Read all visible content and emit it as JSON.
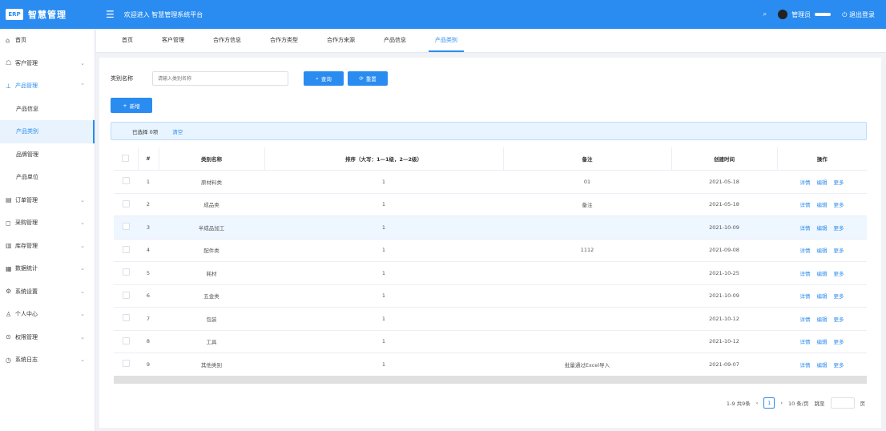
{
  "header": {
    "logo_badge": "ERP",
    "logo_text": "智慧管理",
    "app_title": "欢迎进入 智慧管理系统平台",
    "search_icon": "search-icon",
    "user_name": "管理员",
    "logout": "退出登录"
  },
  "sidebar": {
    "items": [
      {
        "label": "首页",
        "icon": "home-icon",
        "has_arrow": false
      },
      {
        "label": "客户管理",
        "icon": "user-icon",
        "has_arrow": true
      },
      {
        "label": "产品管理",
        "icon": "box-icon",
        "has_arrow": true,
        "open": true
      },
      {
        "label": "产品信息",
        "sub": true
      },
      {
        "label": "产品类别",
        "sub": true,
        "active": true
      },
      {
        "label": "品牌管理",
        "sub": true
      },
      {
        "label": "产品单位",
        "sub": true
      },
      {
        "label": "订单管理",
        "icon": "order-icon",
        "has_arrow": true
      },
      {
        "label": "采购管理",
        "icon": "cart-icon",
        "has_arrow": true
      },
      {
        "label": "库存管理",
        "icon": "stock-icon",
        "has_arrow": true
      },
      {
        "label": "数据统计",
        "icon": "chart-icon",
        "has_arrow": true
      },
      {
        "label": "系统设置",
        "icon": "gear-icon",
        "has_arrow": true
      },
      {
        "label": "个人中心",
        "icon": "person-icon",
        "has_arrow": true
      },
      {
        "label": "权限管理",
        "icon": "lock-icon",
        "has_arrow": true
      },
      {
        "label": "系统日志",
        "icon": "log-icon",
        "has_arrow": true
      }
    ]
  },
  "tabs": [
    "首页",
    "客户管理",
    "合作方信息",
    "合作方类型",
    "合作方来源",
    "产品信息",
    "产品类别"
  ],
  "active_tab": 6,
  "search": {
    "label": "类别名称",
    "placeholder": "请输入类别名称",
    "search_btn": "查询",
    "reset_btn": "重置"
  },
  "add_btn": "新增",
  "selection": {
    "text": "已选择 0项",
    "clear": "清空"
  },
  "table": {
    "columns": [
      "#",
      "类别名称",
      "排序（大写：1—1级，2—2级）",
      "备注",
      "创建时间",
      "操作"
    ],
    "rows": [
      {
        "no": "1",
        "name": "原材料类",
        "sort": "1",
        "remark": "01",
        "date": "2021-05-18"
      },
      {
        "no": "2",
        "name": "成品类",
        "sort": "1",
        "remark": "备注",
        "date": "2021-05-18"
      },
      {
        "no": "3",
        "name": "半成品加工",
        "sort": "1",
        "remark": "",
        "date": "2021-10-09"
      },
      {
        "no": "4",
        "name": "配件类",
        "sort": "1",
        "remark": "1112",
        "date": "2021-09-08"
      },
      {
        "no": "5",
        "name": "耗材",
        "sort": "1",
        "remark": "",
        "date": "2021-10-25"
      },
      {
        "no": "6",
        "name": "五金类",
        "sort": "1",
        "remark": "",
        "date": "2021-10-09"
      },
      {
        "no": "7",
        "name": "包装",
        "sort": "1",
        "remark": "",
        "date": "2021-10-12"
      },
      {
        "no": "8",
        "name": "工具",
        "sort": "1",
        "remark": "",
        "date": "2021-10-12"
      },
      {
        "no": "9",
        "name": "其他类别",
        "sort": "1",
        "remark": "批量通过Excel导入",
        "date": "2021-09-07"
      }
    ],
    "highlight_row": 2,
    "ops": [
      "详情",
      "编辑",
      "更多"
    ]
  },
  "pager": {
    "summary": "1-9 共9条",
    "prev": "‹",
    "current": "1",
    "next": "›",
    "page_size": "10 条/页",
    "goto_label": "跳至",
    "goto_suffix": "页"
  },
  "colors": {
    "primary": "#2a8cf0",
    "highlight": "#eef6ff"
  }
}
